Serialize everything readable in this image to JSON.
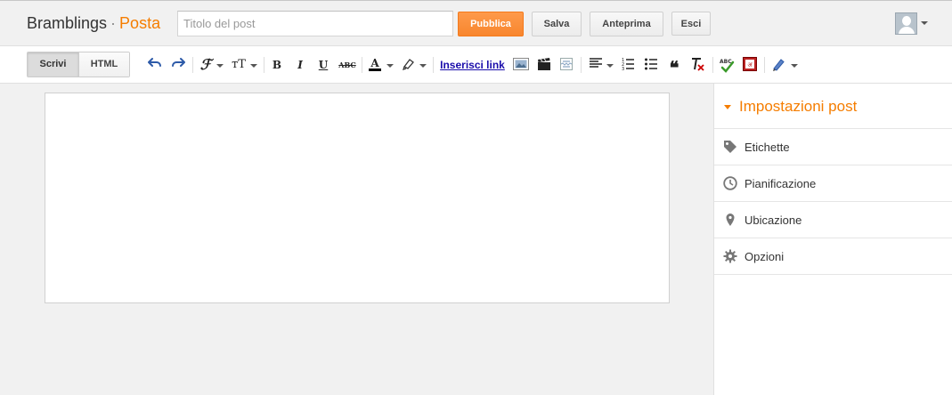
{
  "header": {
    "blog_name": "Bramblings",
    "separator": "·",
    "section": "Posta",
    "title_placeholder": "Titolo del post",
    "title_value": "",
    "publish_label": "Pubblica",
    "save_label": "Salva",
    "preview_label": "Anteprima",
    "exit_label": "Esci",
    "accent_color": "#f57d00"
  },
  "toolbar": {
    "mode_write": "Scrivi",
    "mode_html": "HTML",
    "active_mode": "Scrivi",
    "insert_link_label": "Inserisci link",
    "strike_label": "ABC",
    "spell_label": "ABC",
    "icons": [
      "undo-icon",
      "redo-icon",
      "font-family-icon",
      "font-size-icon",
      "bold-icon",
      "italic-icon",
      "underline-icon",
      "strikethrough-icon",
      "text-color-icon",
      "highlight-icon",
      "insert-image-icon",
      "insert-video-icon",
      "insert-jump-break-icon",
      "align-icon",
      "numbered-list-icon",
      "bulleted-list-icon",
      "quote-icon",
      "clear-formatting-icon",
      "spellcheck-icon",
      "translit-icon",
      "pencil-icon"
    ]
  },
  "sidebar": {
    "title": "Impostazioni post",
    "items": [
      {
        "label": "Etichette",
        "icon": "tag-icon"
      },
      {
        "label": "Pianificazione",
        "icon": "clock-icon"
      },
      {
        "label": "Ubicazione",
        "icon": "location-pin-icon"
      },
      {
        "label": "Opzioni",
        "icon": "gear-icon"
      }
    ]
  }
}
